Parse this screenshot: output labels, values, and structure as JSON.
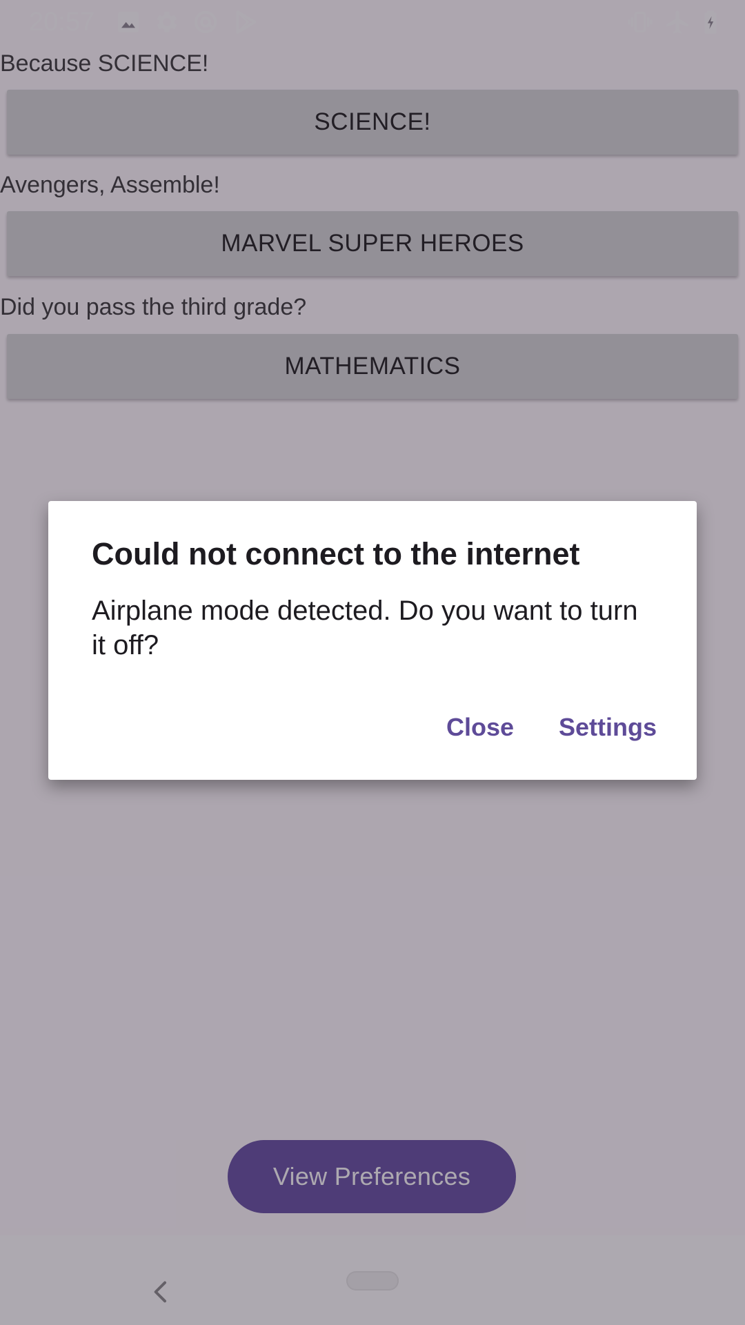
{
  "status_bar": {
    "time": "20:57",
    "left_icons": [
      "image-icon",
      "gear-icon",
      "at-sign-icon",
      "play-store-icon"
    ],
    "right_icons": [
      "vibrate-icon",
      "airplane-icon",
      "battery-charging-icon"
    ]
  },
  "sections": [
    {
      "caption": "Because SCIENCE!",
      "button_label": "SCIENCE!"
    },
    {
      "caption": "Avengers, Assemble!",
      "button_label": "MARVEL SUPER HEROES"
    },
    {
      "caption": "Did you pass the third grade?",
      "button_label": "MATHEMATICS"
    }
  ],
  "view_preferences_label": "View Preferences",
  "dialog": {
    "title": "Could not connect to the internet",
    "message": "Airplane mode detected. Do you want to turn it off?",
    "close_label": "Close",
    "settings_label": "Settings"
  },
  "colors": {
    "accent": "#6750a4",
    "dialog_button_text": "#5e4b98",
    "category_button_bg": "#d6d7d7"
  }
}
